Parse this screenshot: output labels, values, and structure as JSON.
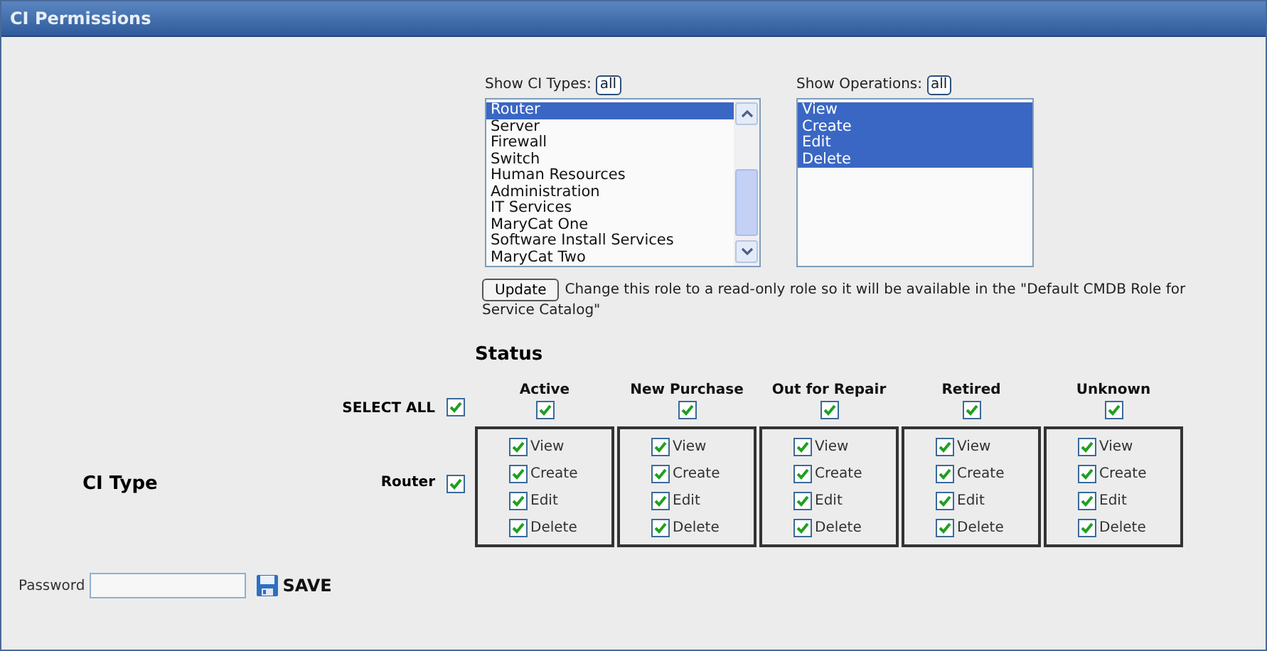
{
  "window": {
    "title": "CI Permissions"
  },
  "ci_types": {
    "label": "Show CI Types:",
    "all_button": "all",
    "items": [
      {
        "label": "Router",
        "selected": true
      },
      {
        "label": "Server",
        "selected": false
      },
      {
        "label": "Firewall",
        "selected": false
      },
      {
        "label": "Switch",
        "selected": false
      },
      {
        "label": "Human Resources",
        "selected": false
      },
      {
        "label": "Administration",
        "selected": false
      },
      {
        "label": "IT Services",
        "selected": false
      },
      {
        "label": "MaryCat One",
        "selected": false
      },
      {
        "label": "Software Install Services",
        "selected": false
      },
      {
        "label": "MaryCat Two",
        "selected": false
      }
    ]
  },
  "operations": {
    "label": "Show Operations:",
    "all_button": "all",
    "items": [
      {
        "label": "View",
        "selected": true
      },
      {
        "label": "Create",
        "selected": true
      },
      {
        "label": "Edit",
        "selected": true
      },
      {
        "label": "Delete",
        "selected": true
      }
    ]
  },
  "update_button": "Update",
  "update_note": "Change this role to a read-only role so it will be available in the \"Default CMDB Role for Service Catalog\"",
  "status_heading": "Status",
  "ci_type_heading": "CI Type",
  "select_all": {
    "label": "SELECT ALL",
    "checked": true
  },
  "statuses": [
    {
      "label": "Active",
      "checked": true
    },
    {
      "label": "New Purchase",
      "checked": true
    },
    {
      "label": "Out for Repair",
      "checked": true
    },
    {
      "label": "Retired",
      "checked": true
    },
    {
      "label": "Unknown",
      "checked": true
    }
  ],
  "rows": [
    {
      "label": "Router",
      "checked": true,
      "cells": [
        [
          {
            "label": "View",
            "checked": true
          },
          {
            "label": "Create",
            "checked": true
          },
          {
            "label": "Edit",
            "checked": true
          },
          {
            "label": "Delete",
            "checked": true
          }
        ],
        [
          {
            "label": "View",
            "checked": true
          },
          {
            "label": "Create",
            "checked": true
          },
          {
            "label": "Edit",
            "checked": true
          },
          {
            "label": "Delete",
            "checked": true
          }
        ],
        [
          {
            "label": "View",
            "checked": true
          },
          {
            "label": "Create",
            "checked": true
          },
          {
            "label": "Edit",
            "checked": true
          },
          {
            "label": "Delete",
            "checked": true
          }
        ],
        [
          {
            "label": "View",
            "checked": true
          },
          {
            "label": "Create",
            "checked": true
          },
          {
            "label": "Edit",
            "checked": true
          },
          {
            "label": "Delete",
            "checked": true
          }
        ],
        [
          {
            "label": "View",
            "checked": true
          },
          {
            "label": "Create",
            "checked": true
          },
          {
            "label": "Edit",
            "checked": true
          },
          {
            "label": "Delete",
            "checked": true
          }
        ]
      ]
    }
  ],
  "password": {
    "label": "Password"
  },
  "save_button": "SAVE"
}
